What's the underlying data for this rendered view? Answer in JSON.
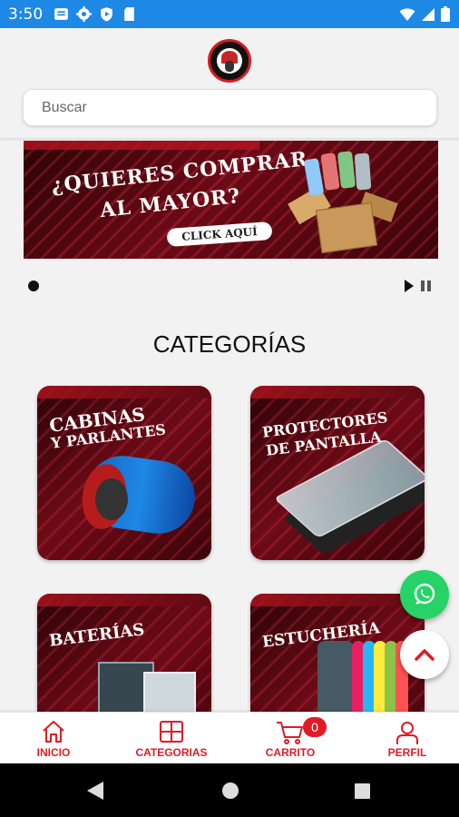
{
  "status_bar": {
    "time": "3:50",
    "left_icons": [
      "message-icon",
      "gear-icon",
      "play-protect-icon",
      "sd-card-icon"
    ],
    "right_icons": [
      "wifi-icon",
      "signal-icon",
      "battery-icon"
    ],
    "color": "#1e88e5"
  },
  "header": {
    "logo": "store-logo-icon",
    "search": {
      "placeholder": "Buscar",
      "value": ""
    }
  },
  "banner": {
    "line1": "¿QUIERES COMPRAR",
    "line2": "AL MAYOR?",
    "cta": "CLICK AQUÍ",
    "carousel_active_index": 0,
    "controls": [
      "play-icon",
      "pause-icon"
    ]
  },
  "categories": {
    "title": "CATEGORÍAS",
    "items": [
      {
        "line1": "CABINAS",
        "line2": "Y PARLANTES"
      },
      {
        "line1": "PROTECTORES",
        "line2": "DE PANTALLA"
      },
      {
        "line1": "BATERÍAS",
        "line2": ""
      },
      {
        "line1": "ESTUCHERÍA",
        "line2": ""
      }
    ]
  },
  "floating": {
    "whatsapp": "whatsapp-icon",
    "scroll_top": "chevron-up-icon"
  },
  "bottom_nav": {
    "items": [
      {
        "label": "INICIO",
        "icon": "home-icon"
      },
      {
        "label": "CATEGORIAS",
        "icon": "grid-icon"
      },
      {
        "label": "CARRITO",
        "icon": "cart-icon"
      },
      {
        "label": "PERFIL",
        "icon": "user-icon"
      }
    ],
    "cart_count": "0",
    "accent": "#e01b24"
  },
  "system_nav": [
    "back-icon",
    "home-circle-icon",
    "recents-icon"
  ]
}
